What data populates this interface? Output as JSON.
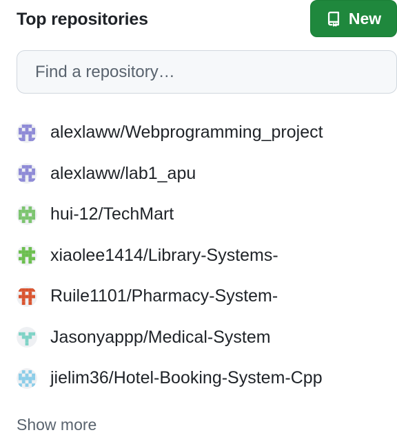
{
  "header": {
    "title": "Top repositories",
    "new_button_label": "New"
  },
  "search": {
    "placeholder": "Find a repository…",
    "value": ""
  },
  "repositories": [
    {
      "name": "alexlaww/Webprogramming_project",
      "avatar_icon": "identicon-purple",
      "avatar_color": "#8e8ad6"
    },
    {
      "name": "alexlaww/lab1_apu",
      "avatar_icon": "identicon-purple",
      "avatar_color": "#8e8ad6"
    },
    {
      "name": "hui-12/TechMart",
      "avatar_icon": "identicon-green",
      "avatar_color": "#7cc46f"
    },
    {
      "name": "xiaolee1414/Library-Systems-",
      "avatar_icon": "identicon-green",
      "avatar_color": "#6cbf4f"
    },
    {
      "name": "Ruile1101/Pharmacy-System-",
      "avatar_icon": "identicon-red",
      "avatar_color": "#d9542f"
    },
    {
      "name": "Jasonyappp/Medical-System",
      "avatar_icon": "identicon-teal",
      "avatar_color": "#7fd3c6"
    },
    {
      "name": "jielim36/Hotel-Booking-System-Cpp",
      "avatar_icon": "identicon-light-blue",
      "avatar_color": "#8ccde8"
    }
  ],
  "show_more_label": "Show more",
  "colors": {
    "new_button_bg": "#1f883d",
    "text_primary": "#1f2328",
    "text_muted": "#59636e",
    "search_bg": "#f6f8fa",
    "search_border": "#d0d7de"
  }
}
